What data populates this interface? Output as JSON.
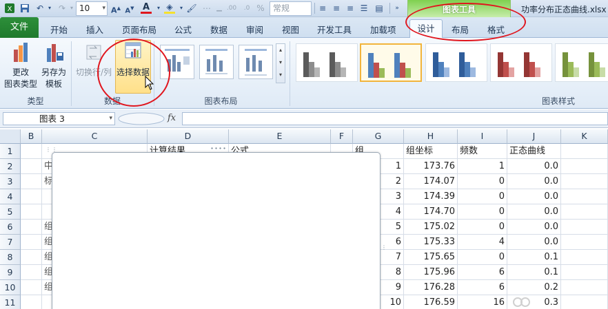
{
  "quick_access": {
    "font_size": "10",
    "number_format": "常规"
  },
  "context_tab_group": {
    "title": "图表工具"
  },
  "document_title": "功率分布正态曲线.xlsx",
  "tabs": {
    "file": "文件",
    "items": [
      "开始",
      "插入",
      "页面布局",
      "公式",
      "数据",
      "审阅",
      "视图",
      "开发工具",
      "加载项"
    ],
    "chart_tabs": [
      "设计",
      "布局",
      "格式"
    ]
  },
  "ribbon": {
    "type_group": {
      "label": "类型",
      "change_type": [
        "更改",
        "图表类型"
      ],
      "save_template": [
        "另存为",
        "模板"
      ]
    },
    "data_group": {
      "label": "数据",
      "switch_row_col": "切换行/列",
      "select_data": "选择数据"
    },
    "layout_group": {
      "label": "图表布局"
    },
    "style_group": {
      "label": "图表样式",
      "styles": [
        {
          "colors": [
            "#5b5b5b",
            "#8c8c8c",
            "#b5b5b5"
          ]
        },
        {
          "colors": [
            "#4f81bd",
            "#c0504d",
            "#9bbb59"
          ]
        },
        {
          "colors": [
            "#2f5d9a",
            "#4f81bd",
            "#9db9e0"
          ]
        },
        {
          "colors": [
            "#943634",
            "#c0504d",
            "#e3a3a2"
          ]
        },
        {
          "colors": [
            "#76923c",
            "#9bbb59",
            "#c8dca7"
          ]
        }
      ]
    }
  },
  "formula_bar": {
    "name_box": "图表 3",
    "fx": "fx",
    "formula": ""
  },
  "grid": {
    "columns": [
      "B",
      "C",
      "D",
      "E",
      "F",
      "G",
      "H",
      "I",
      "J",
      "K"
    ],
    "rows": [
      "1",
      "2",
      "3",
      "4",
      "5",
      "6",
      "7",
      "8",
      "9",
      "10",
      "11"
    ],
    "partial_cells": {
      "d1": "计算结果",
      "e1": "公式",
      "g1": "组"
    },
    "header_row": {
      "h": "组坐标",
      "i": "频数",
      "j": "正态曲线"
    },
    "data_rows": [
      {
        "g": "1",
        "h": "173.76",
        "i": "1",
        "j": "0.0"
      },
      {
        "g": "2",
        "h": "174.07",
        "i": "0",
        "j": "0.0"
      },
      {
        "g": "3",
        "h": "174.39",
        "i": "0",
        "j": "0.0"
      },
      {
        "g": "4",
        "h": "174.70",
        "i": "0",
        "j": "0.0"
      },
      {
        "g": "5",
        "h": "175.02",
        "i": "0",
        "j": "0.0"
      },
      {
        "g": "6",
        "h": "175.33",
        "i": "4",
        "j": "0.0"
      },
      {
        "g": "7",
        "h": "175.65",
        "i": "0",
        "j": "0.1"
      },
      {
        "g": "8",
        "h": "175.96",
        "i": "6",
        "j": "0.1"
      },
      {
        "g": "9",
        "h": "176.28",
        "i": "6",
        "j": "0.2"
      },
      {
        "g": "10",
        "h": "176.59",
        "i": "16",
        "j": "0.3"
      }
    ],
    "left_fragments": [
      "中",
      "标",
      "",
      "",
      "组",
      "组",
      "组",
      "组",
      "组"
    ]
  }
}
